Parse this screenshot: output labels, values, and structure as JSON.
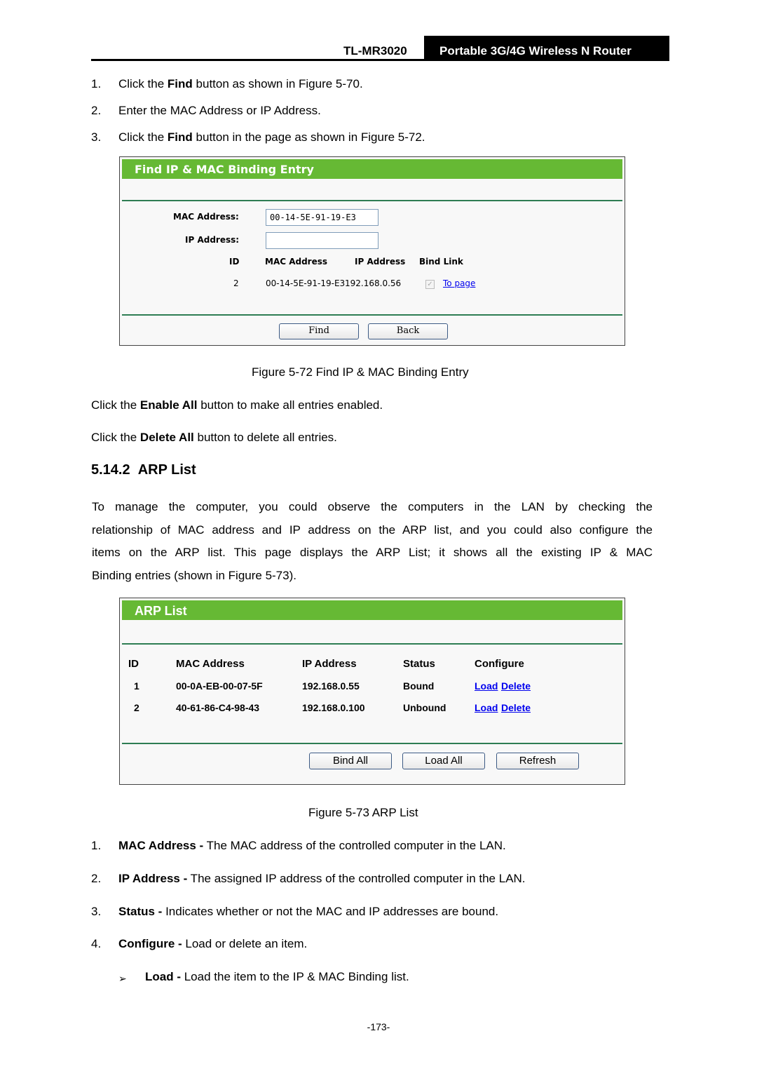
{
  "header": {
    "model": "TL-MR3020",
    "product": "Portable 3G/4G Wireless N Router"
  },
  "steps_top": [
    {
      "num": "1.",
      "pre": "Click the ",
      "bold": "Find",
      "post": " button as shown in Figure 5-70."
    },
    {
      "num": "2.",
      "pre": "Enter the MAC Address or IP Address.",
      "bold": "",
      "post": ""
    },
    {
      "num": "3.",
      "pre": "Click the ",
      "bold": "Find",
      "post": " button in the page as shown in Figure 5-72."
    }
  ],
  "find_figure": {
    "title": "Find IP & MAC Binding Entry",
    "mac_label": "MAC Address:",
    "mac_value": "00-14-5E-91-19-E3",
    "ip_label": "IP Address:",
    "ip_value": "",
    "columns": [
      "ID",
      "MAC Address",
      "IP Address",
      "Bind Link"
    ],
    "row": {
      "id": "2",
      "mac": "00-14-5E-91-19-E3",
      "ip": "192.168.0.56",
      "bind_checked": true,
      "link": "To page"
    },
    "find_button": "Find",
    "back_button": "Back",
    "caption": "Figure 5-72    Find IP & MAC Binding Entry"
  },
  "para_enable": {
    "pre": "Click the ",
    "bold": "Enable All",
    "post": " button to make all entries enabled."
  },
  "para_delete": {
    "pre": "Click the ",
    "bold": "Delete All",
    "post": " button to delete all entries."
  },
  "section": {
    "number": "5.14.2",
    "title": "ARP List"
  },
  "intro_lines": [
    "To manage the computer, you could observe the computers in the LAN by checking the",
    "relationship of MAC address and IP address on the ARP list, and you could also configure the",
    "items on the ARP list. This page displays the ARP List; it shows all the existing IP & MAC",
    "Binding entries (shown in Figure 5-73)."
  ],
  "arp_figure": {
    "title": "ARP List",
    "columns": [
      "ID",
      "MAC Address",
      "IP Address",
      "Status",
      "Configure"
    ],
    "rows": [
      {
        "id": "1",
        "mac": "00-0A-EB-00-07-5F",
        "ip": "192.168.0.55",
        "status": "Bound",
        "load": "Load",
        "delete": "Delete"
      },
      {
        "id": "2",
        "mac": "40-61-86-C4-98-43",
        "ip": "192.168.0.100",
        "status": "Unbound",
        "load": "Load",
        "delete": "Delete"
      }
    ],
    "buttons": [
      "Bind All",
      "Load All",
      "Refresh"
    ],
    "caption": "Figure 5-73    ARP List"
  },
  "definitions": [
    {
      "num": "1.",
      "term": "MAC Address -",
      "text": " The MAC address of the controlled computer in the LAN."
    },
    {
      "num": "2.",
      "term": "IP Address -",
      "text": " The assigned IP address of the controlled computer in the LAN."
    },
    {
      "num": "3.",
      "term": "Status -",
      "text": " Indicates whether or not the MAC and IP addresses are bound."
    },
    {
      "num": "4.",
      "term": "Configure -",
      "text": " Load or delete an item."
    }
  ],
  "sub_definition": {
    "bullet": "➢",
    "term": "Load -",
    "text": " Load the item to the IP & MAC Binding list."
  },
  "page_number": "-173-"
}
